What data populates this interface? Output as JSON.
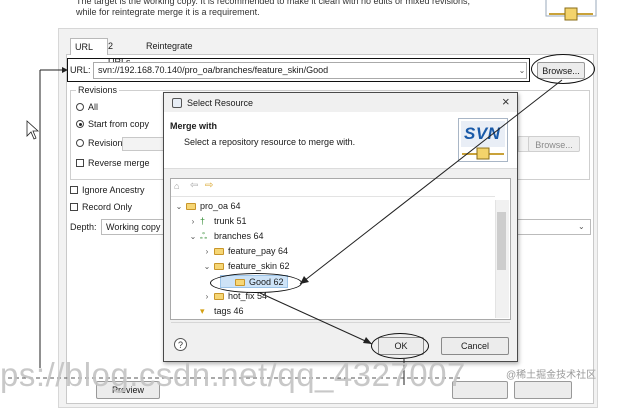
{
  "top": {
    "description_text": "The target is the working copy. It is recommended to make it clean with no edits or mixed revisions,\nwhile for reintegrate merge it is a requirement."
  },
  "tabs": [
    {
      "label": "URL",
      "active": true
    },
    {
      "label": "2 URLs",
      "active": false
    },
    {
      "label": "Reintegrate",
      "active": false
    }
  ],
  "url": {
    "label": "URL:",
    "value": "svn://192.168.70.140/pro_oa/branches/feature_skin/Good",
    "browse_label": "Browse..."
  },
  "revisions": {
    "group_label": "Revisions",
    "all_label": "All",
    "start_from_copy_label": "Start from copy",
    "revisions_label": "Revisions:",
    "reverse_merge_label": "Reverse merge",
    "browse_label": "Browse...",
    "selected": "Start from copy"
  },
  "options": {
    "ignore_ancestry_label": "Ignore Ancestry",
    "record_only_label": "Record Only",
    "depth_label": "Depth:",
    "depth_value": "Working copy"
  },
  "bottom": {
    "preview_label": "Preview"
  },
  "dialog": {
    "title": "Select Resource",
    "close_glyph": "×",
    "heading": "Merge with",
    "subtitle": "Select a repository resource to merge with.",
    "logo_text": "SVN",
    "ok_label": "OK",
    "cancel_label": "Cancel",
    "help_glyph": "?"
  },
  "tree": {
    "items": [
      {
        "label": "pro_oa 64",
        "twisty": "⌄",
        "icon": "folder-icon"
      },
      {
        "label": "trunk 51",
        "twisty": "›",
        "icon": "trunk-icon"
      },
      {
        "label": "branches 64",
        "twisty": "⌄",
        "icon": "branches-icon"
      },
      {
        "label": "feature_pay 64",
        "twisty": "›",
        "icon": "folder-icon"
      },
      {
        "label": "feature_skin 62",
        "twisty": "⌄",
        "icon": "folder-icon"
      },
      {
        "label": "Good 62",
        "twisty": "",
        "icon": "folder-icon",
        "selected": true
      },
      {
        "label": "hot_fix 54",
        "twisty": "›",
        "icon": "folder-icon"
      },
      {
        "label": "tags 46",
        "twisty": "",
        "icon": "tags-icon"
      }
    ]
  },
  "watermark": {
    "text": "ps://blog.csdn.net/qq_4327007",
    "badge": "@稀土掘金技术社区"
  },
  "colors": {
    "svn_logo_blue": "#1a5aa8",
    "folder_yellow": "#f6d675",
    "selection_blue": "#cde3f7"
  }
}
